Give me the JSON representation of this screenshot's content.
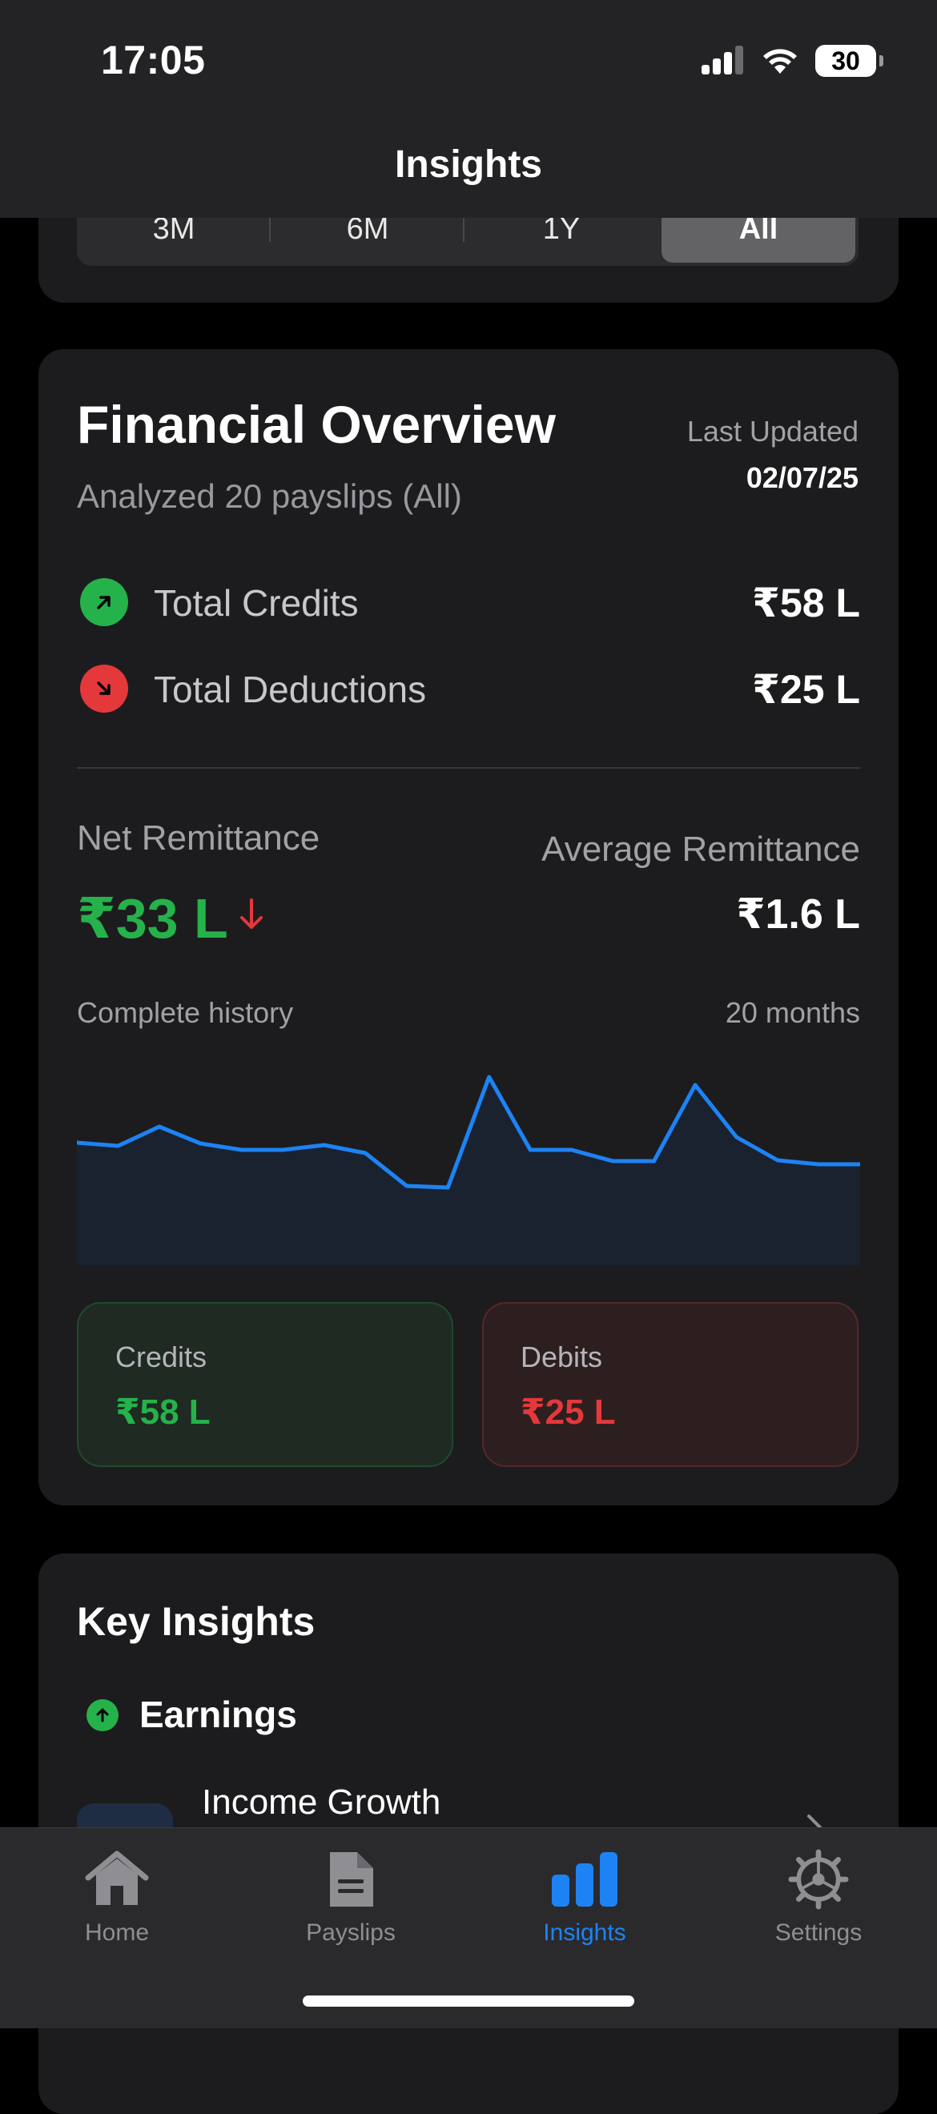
{
  "status_bar": {
    "time": "17:05",
    "battery": "30"
  },
  "nav": {
    "title": "Insights"
  },
  "segments": [
    {
      "label": "3M",
      "active": false
    },
    {
      "label": "6M",
      "active": false
    },
    {
      "label": "1Y",
      "active": false
    },
    {
      "label": "All",
      "active": true
    }
  ],
  "overview": {
    "title": "Financial Overview",
    "subtitle": "Analyzed 20 payslips (All)",
    "last_updated_label": "Last Updated",
    "last_updated_date": "02/07/25",
    "total_credits_label": "Total Credits",
    "total_credits_value": "₹58 L",
    "total_deductions_label": "Total Deductions",
    "total_deductions_value": "₹25 L",
    "net_label": "Net Remittance",
    "net_value": "₹33 L",
    "avg_label": "Average Remittance",
    "avg_value": "₹1.6 L",
    "history_label": "Complete history",
    "months_label": "20 months",
    "credits_label": "Credits",
    "credits_value": "₹58 L",
    "debits_label": "Debits",
    "debits_value": "₹25 L"
  },
  "chart_data": {
    "type": "area",
    "x": [
      1,
      2,
      3,
      4,
      5,
      6,
      7,
      8,
      9,
      10,
      11,
      12,
      13,
      14,
      15,
      16,
      17,
      18,
      19,
      20
    ],
    "values": [
      1.53,
      1.49,
      1.73,
      1.52,
      1.44,
      1.44,
      1.5,
      1.4,
      0.99,
      0.97,
      2.35,
      1.44,
      1.44,
      1.3,
      1.3,
      2.25,
      1.6,
      1.31,
      1.26,
      1.26
    ],
    "ylabel": "",
    "xlabel": "",
    "ylim": [
      0,
      2.5
    ],
    "color": "#1d83f5"
  },
  "key_insights": {
    "title": "Key Insights",
    "section": "Earnings",
    "item": "Income Growth"
  },
  "tabs": [
    {
      "label": "Home",
      "icon": "house-icon",
      "active": false
    },
    {
      "label": "Payslips",
      "icon": "document-icon",
      "active": false
    },
    {
      "label": "Insights",
      "icon": "bar-chart-icon",
      "active": true
    },
    {
      "label": "Settings",
      "icon": "gear-icon",
      "active": false
    }
  ],
  "colors": {
    "accent": "#1d83f5",
    "positive": "#25b24a",
    "negative": "#e5383b"
  }
}
